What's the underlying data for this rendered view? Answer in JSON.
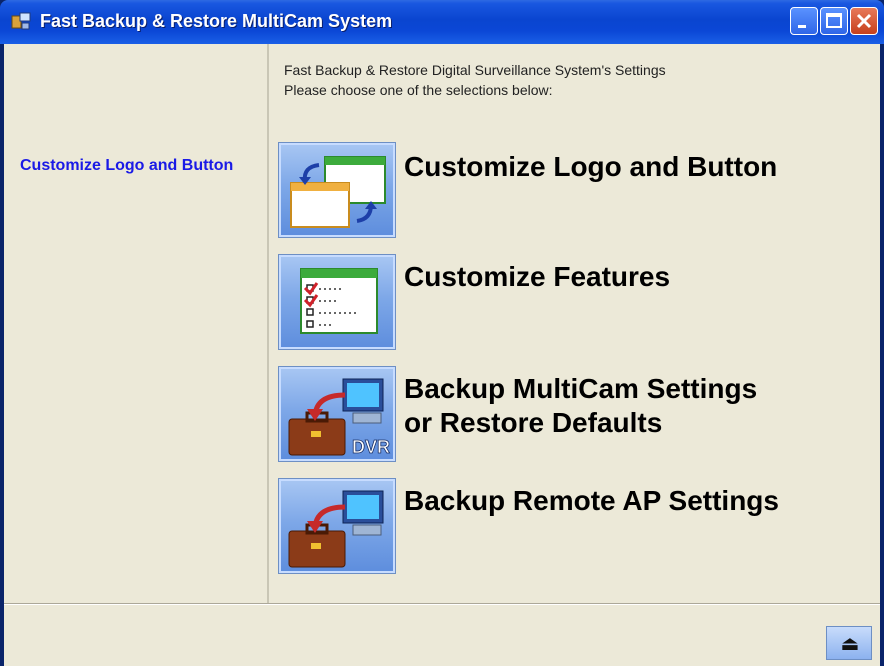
{
  "window": {
    "title": "Fast Backup & Restore MultiCam System"
  },
  "sidebar": {
    "active_item": "Customize Logo and Button"
  },
  "header": {
    "line1": "Fast Backup & Restore Digital Surveillance System's Settings",
    "line2": "Please choose one of the selections below:"
  },
  "options": [
    {
      "label": "Customize Logo and Button",
      "icon": "customize-logo-icon"
    },
    {
      "label": "Customize Features",
      "icon": "checklist-icon"
    },
    {
      "label_line1": "Backup MultiCam Settings",
      "label_line2": "or Restore Defaults",
      "icon": "briefcase-dvr-icon",
      "icon_badge": "DVR"
    },
    {
      "label": "Backup Remote AP Settings",
      "icon": "briefcase-computer-icon"
    }
  ],
  "footer": {
    "eject_symbol": "⏏"
  }
}
